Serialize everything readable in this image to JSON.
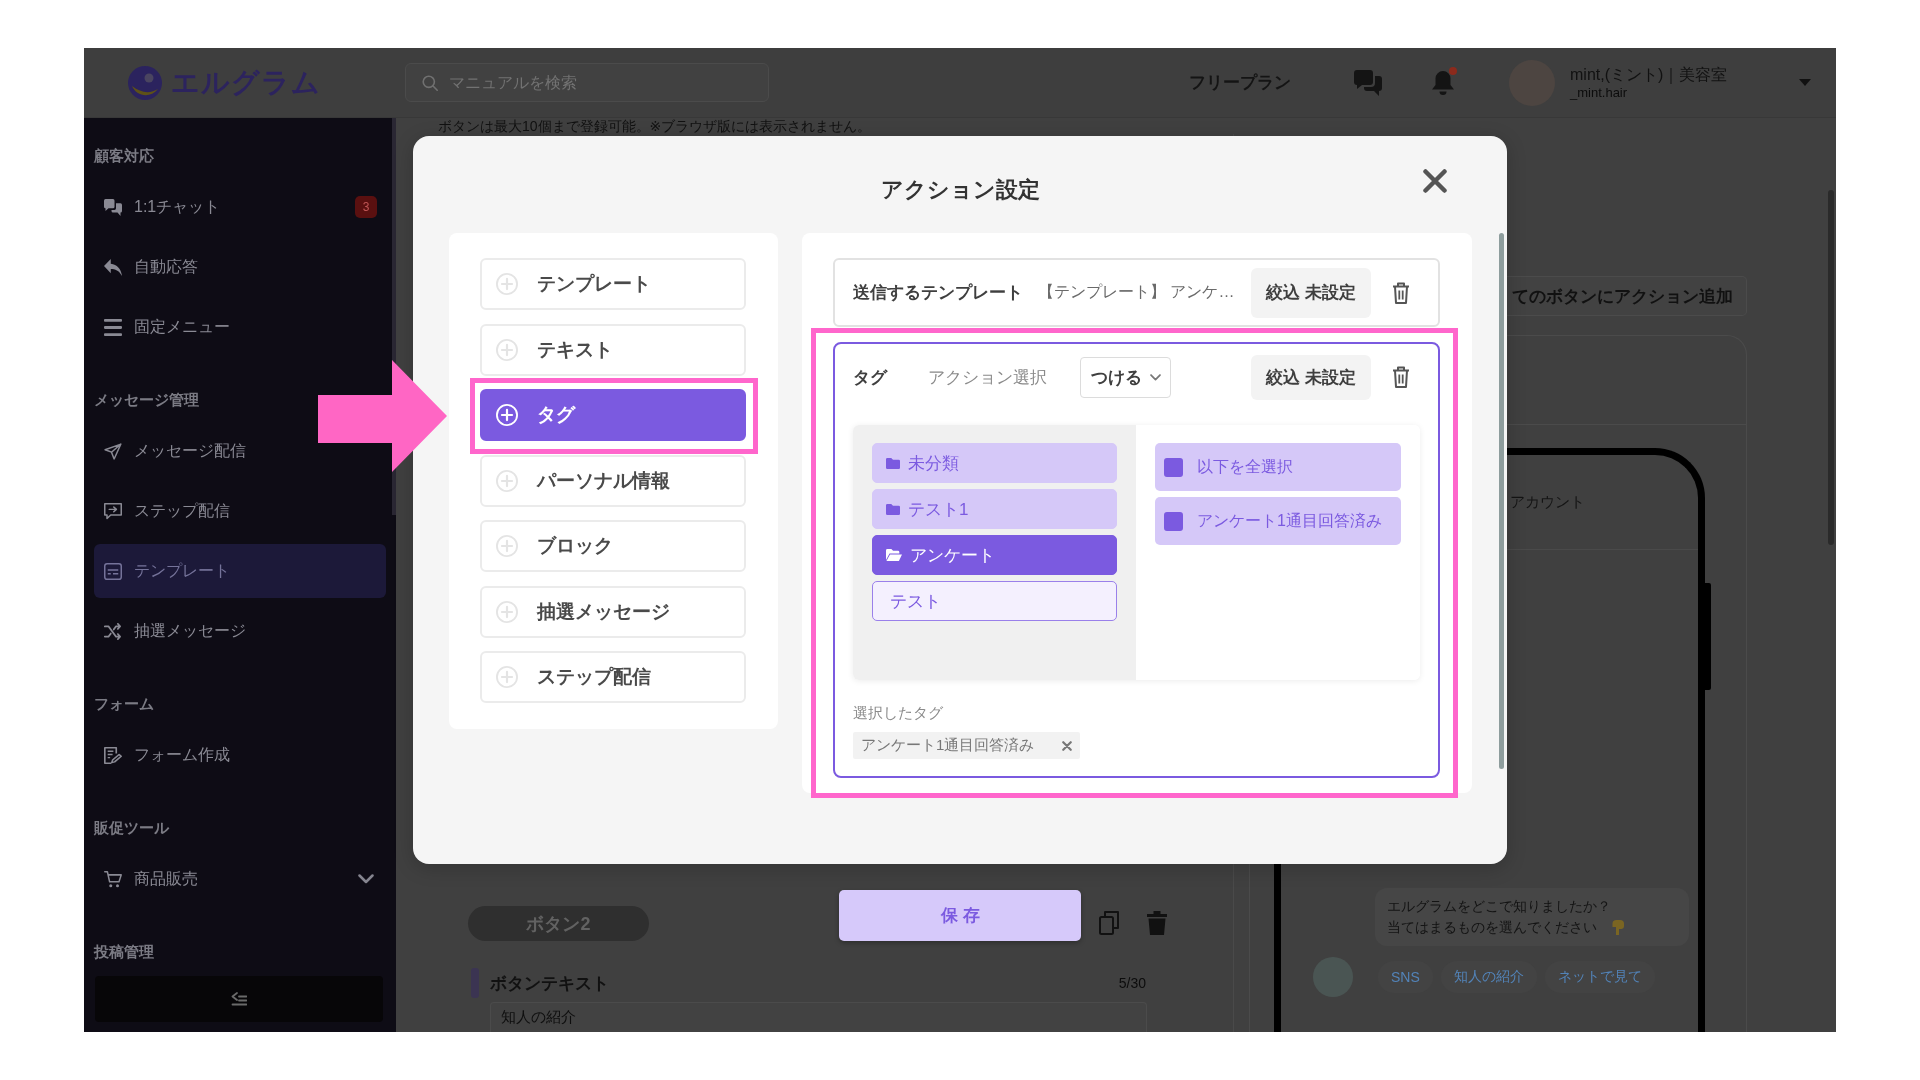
{
  "header": {
    "logo": "エルグラム",
    "search": {
      "placeholder": "マニュアルを検索"
    },
    "plan": "フリープラン",
    "notifications": {
      "unread": true
    },
    "user": {
      "name": "mint,(ミント)｜美容室",
      "handle": "_mint.hair"
    }
  },
  "sidebar": {
    "sections": [
      {
        "title": "顧客対応",
        "items": [
          {
            "label": "1:1チャット",
            "badge": "3",
            "selected": false
          },
          {
            "label": "自動応答",
            "selected": false
          },
          {
            "label": "固定メニュー",
            "selected": false
          }
        ]
      },
      {
        "title": "メッセージ管理",
        "items": [
          {
            "label": "メッセージ配信",
            "selected": false
          },
          {
            "label": "ステップ配信",
            "selected": false
          },
          {
            "label": "テンプレート",
            "selected": true
          },
          {
            "label": "抽選メッセージ",
            "selected": false
          }
        ]
      },
      {
        "title": "フォーム",
        "items": [
          {
            "label": "フォーム作成",
            "selected": false
          }
        ]
      },
      {
        "title": "販促ツール",
        "items": [
          {
            "label": "商品販売",
            "selected": false,
            "expanded": false
          }
        ]
      },
      {
        "title": "投稿管理"
      }
    ]
  },
  "page": {
    "notice": "ボタンは最大10個まで登録可能。※ブラウザ版には表示されません。",
    "button_tab": "ボタン2",
    "save_button": "保存",
    "button_text": {
      "label": "ボタンテキスト",
      "count": "5/30",
      "value": "知人の紹介"
    },
    "add_action_all_button": "てのボタンにアクション追加",
    "preview": {
      "account_name": "アカウント",
      "message_lines": [
        "エルグラムをどこで知りましたか？",
        "当てはまるものを選んでください"
      ],
      "options": [
        "SNS",
        "知人の紹介",
        "ネットで見て"
      ]
    }
  },
  "modal": {
    "title": "アクション設定",
    "action_types": [
      {
        "label": "テンプレート",
        "selected": false,
        "highlighted": false,
        "pointed": false
      },
      {
        "label": "テキスト",
        "selected": false,
        "highlighted": false,
        "pointed": false
      },
      {
        "label": "タグ",
        "selected": true,
        "highlighted": true,
        "pointed": true
      },
      {
        "label": "パーソナル情報",
        "selected": false,
        "highlighted": false,
        "pointed": false
      },
      {
        "label": "ブロック",
        "selected": false,
        "highlighted": false,
        "pointed": false
      },
      {
        "label": "抽選メッセージ",
        "selected": false,
        "highlighted": false,
        "pointed": false
      },
      {
        "label": "ステップ配信",
        "selected": false,
        "highlighted": false,
        "pointed": false
      }
    ],
    "actions": [
      {
        "kind": "template",
        "label": "送信するテンプレート",
        "value": "【テンプレート】 アンケ…",
        "filter_button": "絞込 未設定",
        "highlighted": false
      },
      {
        "kind": "tag",
        "label": "タグ",
        "action_label": "アクション選択",
        "action_select": {
          "value": "つける"
        },
        "filter_button": "絞込 未設定",
        "highlighted": true,
        "folders": [
          {
            "label": "未分類",
            "kind": "folder",
            "selected": false
          },
          {
            "label": "テスト1",
            "kind": "folder",
            "selected": false
          },
          {
            "label": "アンケート",
            "kind": "folder",
            "selected": true
          },
          {
            "label": "テスト",
            "kind": "plain",
            "selected": false
          }
        ],
        "tags": [
          {
            "label": "以下を全選択",
            "checked": true
          },
          {
            "label": "アンケート1通目回答済み",
            "checked": true
          }
        ],
        "selected_label": "選択したタグ",
        "selected_tags": [
          "アンケート1通目回答済み"
        ]
      }
    ]
  }
}
